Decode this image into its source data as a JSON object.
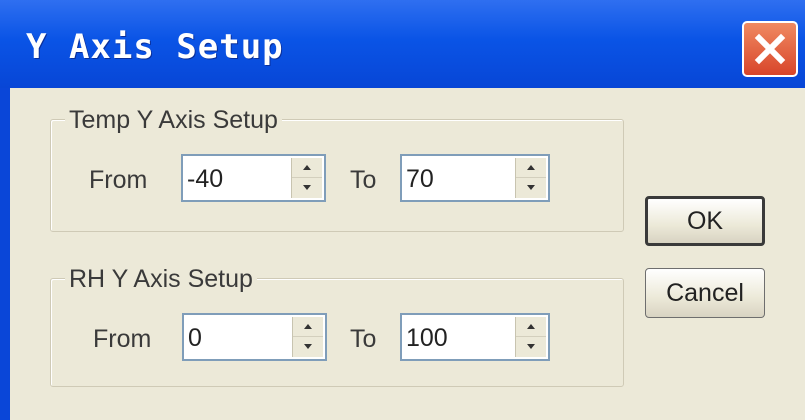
{
  "window": {
    "title": "Y Axis Setup"
  },
  "temp_group": {
    "legend": "Temp Y Axis Setup",
    "from_label": "From",
    "from_value": "-40",
    "to_label": "To",
    "to_value": "70"
  },
  "rh_group": {
    "legend": "RH Y Axis Setup",
    "from_label": "From",
    "from_value": "0",
    "to_label": "To",
    "to_value": "100"
  },
  "buttons": {
    "ok": "OK",
    "cancel": "Cancel"
  },
  "icons": {
    "close": "close-icon",
    "spin_up": "chevron-up-icon",
    "spin_down": "chevron-down-icon"
  },
  "colors": {
    "titlebar": "#0a54e6",
    "close": "#d8452a",
    "client": "#ece9d8"
  }
}
